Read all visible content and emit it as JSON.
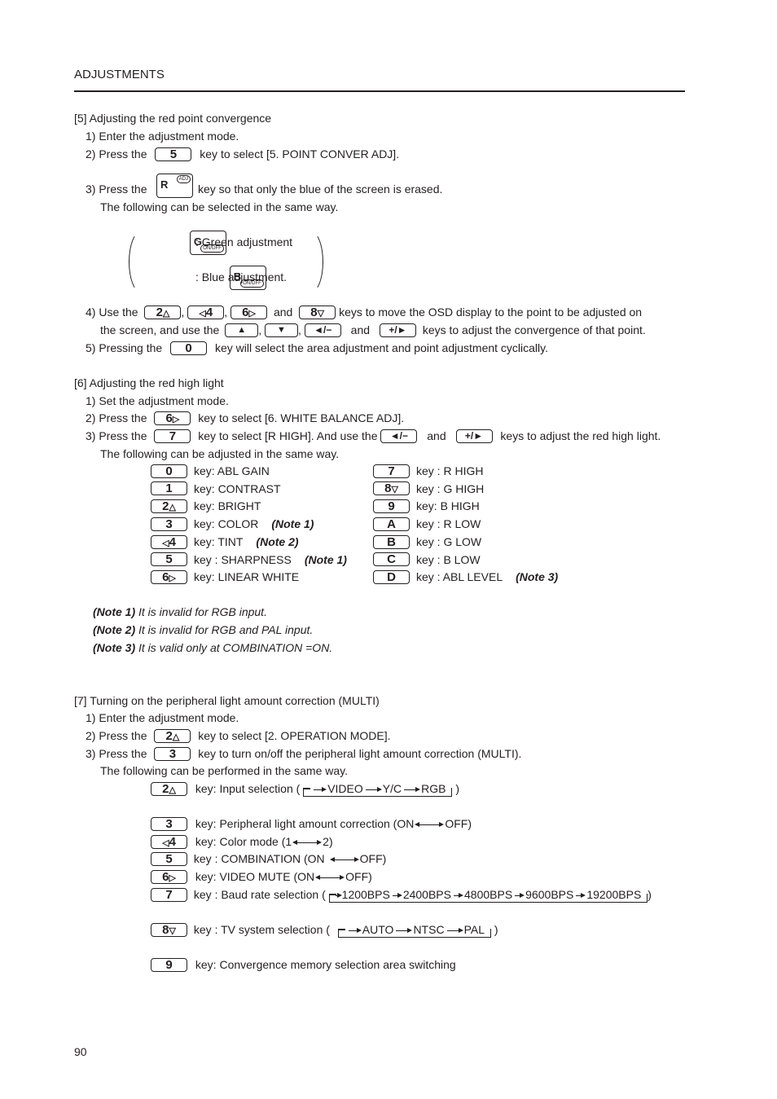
{
  "header": {
    "title": "ADJUSTMENTS"
  },
  "page_number": "90",
  "keys": {
    "k0": "0",
    "k1": "1",
    "k2": "2",
    "k3": "3",
    "k4": "4",
    "k5": "5",
    "k6": "6",
    "k7": "7",
    "k8": "8",
    "k9": "9",
    "kA": "A",
    "kB": "B",
    "kC": "C",
    "kD": "D",
    "kR": "R",
    "kG": "G",
    "kBl": "B",
    "adj": "ADJ",
    "onoff": "ON/OFF",
    "up": "▲",
    "down": "▼",
    "minus": "◄/−",
    "plus": "+/►",
    "arr2": "△",
    "arr4": "◁",
    "arr6": "▷",
    "arr8": "▽"
  },
  "s5": {
    "title": "[5] Adjusting the red point convergence",
    "step1": "1) Enter the adjustment mode.",
    "step2_pre": "2) Press the",
    "step2_post": "key to select [5. POINT CONVER ADJ].",
    "step3_pre": "3) Press the",
    "step3_post": "key so that only the blue of the screen is erased.",
    "step3_sub": "The following can be selected in the same way.",
    "green": ": Green adjustment",
    "blue": ": Blue adjustment.",
    "step4_pre": "4) Use the",
    "comma": ",",
    "and": "and",
    "step4_post": "keys to move the OSD display to the point to be adjusted on",
    "step4b_pre": "the screen, and use the",
    "step4b_post": "keys to adjust the convergence of that point.",
    "step5_pre": "5) Pressing the",
    "step5_post": "key will select the area adjustment and point adjustment cyclically."
  },
  "s6": {
    "title": "[6] Adjusting the red high light",
    "step1": "1) Set the adjustment mode.",
    "step2_pre": "2) Press the",
    "step2_post": "key to select  [6. WHITE BALANCE ADJ].",
    "step3_pre": "3) Press the",
    "step3_mid": "key to select [R HIGH]. And use the",
    "and": "and",
    "step3_post": "keys to adjust the red high light.",
    "step3_sub": "The following can be adjusted in the same way.",
    "left": [
      {
        "key": "0",
        "label": "key:  ABL GAIN",
        "note": ""
      },
      {
        "key": "1",
        "label": "key:  CONTRAST",
        "note": ""
      },
      {
        "key": "2",
        "label": "key:  BRIGHT",
        "note": ""
      },
      {
        "key": "3",
        "label": "key:  COLOR",
        "note": "(Note 1)"
      },
      {
        "key": "4",
        "label": "key:  TINT",
        "note": "(Note 2)"
      },
      {
        "key": "5",
        "label": "key :  SHARPNESS",
        "note": "(Note 1)"
      },
      {
        "key": "6",
        "label": "key:  LINEAR WHITE",
        "note": ""
      }
    ],
    "right": [
      {
        "key": "7",
        "label": "key : R HIGH",
        "note": ""
      },
      {
        "key": "8",
        "label": "key : G HIGH",
        "note": ""
      },
      {
        "key": "9",
        "label": "key: B HIGH",
        "note": ""
      },
      {
        "key": "A",
        "label": "key : R LOW",
        "note": ""
      },
      {
        "key": "B",
        "label": "key : G LOW",
        "note": ""
      },
      {
        "key": "C",
        "label": "key : B LOW",
        "note": ""
      },
      {
        "key": "D",
        "label": "key  : ABL LEVEL",
        "note": "(Note 3)"
      }
    ],
    "notes": [
      {
        "tag": "(Note 1)",
        "text": " It is invalid for RGB input."
      },
      {
        "tag": "(Note 2)",
        "text": " It is invalid for RGB and PAL input."
      },
      {
        "tag": "(Note 3)",
        "text": " It is valid only at COMBINATION =ON."
      }
    ]
  },
  "s7": {
    "title": "[7] Turning on the peripheral light amount correction (MULTI)",
    "step1": "1) Enter the adjustment mode.",
    "step2_pre": "2) Press the",
    "step2_post": "key to select  [2. OPERATION MODE].",
    "step3_pre": "3) Press the",
    "step3_post": "key to turn on/off the peripheral light amount correction (MULTI).",
    "step3_sub": "The following can be performed in the same way.",
    "input": {
      "label": "key:  Input selection (",
      "cycle": [
        "VIDEO",
        "Y/C",
        "RGB"
      ],
      "close": ")"
    },
    "peripheral": {
      "label": "key:  Peripheral light amount correction (ON",
      "b": "OFF)"
    },
    "color": {
      "label": "key:  Color mode (1",
      "b": "2)"
    },
    "combination": {
      "label": "key :  COMBINATION (ON",
      "b": "OFF)"
    },
    "mute": {
      "label": "key:  VIDEO MUTE (ON",
      "b": "OFF)"
    },
    "baud": {
      "label": "key :  Baud rate selection (",
      "cycle": [
        "1200BPS",
        "2400BPS",
        "4800BPS",
        "9600BPS",
        "19200BPS"
      ],
      "close": ")"
    },
    "tv": {
      "label": "key :  TV system selection (",
      "cycle": [
        "AUTO",
        "NTSC",
        "PAL"
      ],
      "close": ")"
    },
    "conv": {
      "label": "key:  Convergence memory selection area switching"
    }
  }
}
